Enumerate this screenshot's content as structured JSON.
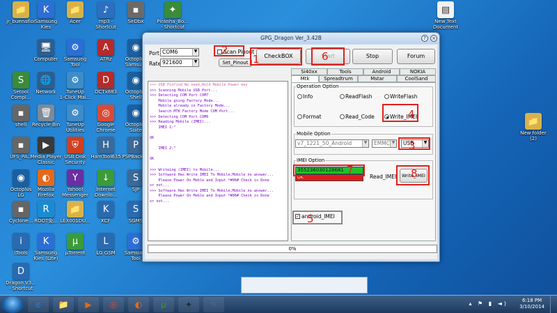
{
  "desktop_icons": [
    {
      "label": "jr_buenaflor",
      "icon": "user-folder-icon",
      "color": "#d7b24a",
      "glyph": "📁"
    },
    {
      "label": "Samsung\nKies",
      "icon": "kies-icon",
      "color": "#2c6ed5",
      "glyph": "K"
    },
    {
      "label": "Acer",
      "icon": "folder-icon",
      "color": "#d7b24a",
      "glyph": "📁"
    },
    {
      "label": "mp3 -\nShortcut",
      "icon": "mp3-icon",
      "color": "#2d6fbf",
      "glyph": "♪"
    },
    {
      "label": "SeDbx",
      "icon": "folder-icon",
      "color": "#6a6a6a",
      "glyph": "▪"
    },
    {
      "label": "Piranha_Bo...\n- Shortcut",
      "icon": "piranha-icon",
      "color": "#3a8b3a",
      "glyph": "✦"
    },
    {
      "label": "Computer",
      "icon": "computer-icon",
      "color": "#2f5d8c",
      "glyph": "🖥"
    },
    {
      "label": "Samsung\nTool",
      "icon": "samsung-tool-icon",
      "color": "#2c6ed5",
      "glyph": "⚙"
    },
    {
      "label": "ATRz",
      "icon": "atrz-icon",
      "color": "#b52a2a",
      "glyph": "A"
    },
    {
      "label": "Octoplus\nSamsu...",
      "icon": "octoplus-icon",
      "color": "#1b5fa0",
      "glyph": "◉"
    },
    {
      "label": "Setool\nCompl...",
      "icon": "setool-icon",
      "color": "#3a8b3a",
      "glyph": "S"
    },
    {
      "label": "Network",
      "icon": "network-icon",
      "color": "#2f5d8c",
      "glyph": "🌐"
    },
    {
      "label": "TuneUp\n1-Click Mai...",
      "icon": "tuneup-icon",
      "color": "#3e8cc8",
      "glyph": "⚙"
    },
    {
      "label": "DCTx883",
      "icon": "dct-icon",
      "color": "#b52a2a",
      "glyph": "D"
    },
    {
      "label": "Octoplus\nShell",
      "icon": "octoplus-shell-icon",
      "color": "#1b5fa0",
      "glyph": "◉"
    },
    {
      "label": "shell",
      "icon": "shell-icon",
      "color": "#666",
      "glyph": "▪"
    },
    {
      "label": "Recycle Bin",
      "icon": "recycle-bin-icon",
      "color": "#7c8a99",
      "glyph": "🗑"
    },
    {
      "label": "TuneUp\nUtilities",
      "icon": "tuneup-utilities-icon",
      "color": "#3e8cc8",
      "glyph": "⚙"
    },
    {
      "label": "Google\nChrome",
      "icon": "chrome-icon",
      "color": "#d84a38",
      "glyph": "◎"
    },
    {
      "label": "Octoplus\nSuite",
      "icon": "octoplus-suite-icon",
      "color": "#1b5fa0",
      "glyph": "◉"
    },
    {
      "label": "UFS_PA...",
      "icon": "ufs-icon",
      "color": "#666",
      "glyph": "▪"
    },
    {
      "label": "Media Player\nClassic",
      "icon": "media-player-icon",
      "color": "#3a3a3a",
      "glyph": "▶"
    },
    {
      "label": "USB Disk\nSecurity",
      "icon": "usb-security-icon",
      "color": "#d04020",
      "glyph": "⛨"
    },
    {
      "label": "HamTool635",
      "icon": "hamtool-icon",
      "color": "#3a6a9a",
      "glyph": "H"
    },
    {
      "label": "PSPBackt...",
      "icon": "psp-icon",
      "color": "#3a6a9a",
      "glyph": "P"
    },
    {
      "label": "Octoplus\nLG",
      "icon": "octoplus-lg-icon",
      "color": "#1b5fa0",
      "glyph": "◉"
    },
    {
      "label": "Mozilla\nFirefox",
      "icon": "firefox-icon",
      "color": "#e36a1a",
      "glyph": "◐"
    },
    {
      "label": "Yahoo!\nMessenger",
      "icon": "yahoo-icon",
      "color": "#6a2fa0",
      "glyph": "Y"
    },
    {
      "label": "Internet\nDownlo...",
      "icon": "idm-icon",
      "color": "#3a9b3a",
      "glyph": "↓"
    },
    {
      "label": "SJP",
      "icon": "sjp-icon",
      "color": "#3a6a9a",
      "glyph": "S"
    },
    {
      "label": "Cyclone...",
      "icon": "cyclone-icon",
      "color": "#666",
      "glyph": "▪"
    },
    {
      "label": "ROOT免...",
      "icon": "root-icon",
      "color": "#1b8ad0",
      "glyph": "R"
    },
    {
      "label": "LEX001DU...",
      "icon": "folder-icon",
      "color": "#d7b24a",
      "glyph": "📁"
    },
    {
      "label": "KCF",
      "icon": "kcf-icon",
      "color": "#2a6ab0",
      "glyph": "K"
    },
    {
      "label": "SGMS",
      "icon": "sgms-icon",
      "color": "#2a6ab0",
      "glyph": "S"
    },
    {
      "label": "iTools",
      "icon": "itools-icon",
      "color": "#2a6ab0",
      "glyph": "i"
    },
    {
      "label": "Samsung\nKies (Lite)",
      "icon": "kies-lite-icon",
      "color": "#2c6ed5",
      "glyph": "K"
    },
    {
      "label": "µTorrent",
      "icon": "utorrent-icon",
      "color": "#3a9b3a",
      "glyph": "µ"
    },
    {
      "label": "LG GSM",
      "icon": "lg-gsm-icon",
      "color": "#2a6ab0",
      "glyph": "L"
    },
    {
      "label": "Samsung\nTool",
      "icon": "samsung-tool-icon",
      "color": "#2c6ed5",
      "glyph": "⚙"
    },
    {
      "label": "Dragon V3...\n- Shortcut",
      "icon": "dragon-icon",
      "color": "#2a6ab0",
      "glyph": "D"
    }
  ],
  "right_icons": [
    {
      "label": "New Text\nDocument",
      "icon": "text-document-icon",
      "color": "#f2f2f2",
      "glyph": "▤"
    },
    {
      "label": "New folder\n(2)",
      "icon": "folder-icon",
      "color": "#d7b24a",
      "glyph": "📁"
    }
  ],
  "window": {
    "title": "GPG_Dragon  Ver_3.42B",
    "port_label": "Port",
    "port_value": "COM6",
    "rate_label": "Rate",
    "rate_value": "921600",
    "scan_pinout_label": "Scan Pinout",
    "set_pinout_label": "Set_Pinout",
    "checkbox_btn": "CheckBOX",
    "start_btn": "Start",
    "stop_btn": "Stop",
    "forum_btn": "Forum",
    "tabs_row1": [
      "Si40xx",
      "Tools",
      "Android",
      "NOKIA"
    ],
    "tabs_row2": [
      "Mtk",
      "Spreadtrum",
      "Mstar",
      "CoolSand"
    ],
    "operation_option_title": "Operation Option",
    "op_info": "Info",
    "op_readflash": "ReadFlash",
    "op_writeflash": "WriteFlash",
    "op_format": "Format",
    "op_read_code": "Read_Code",
    "op_write_imei": "Write_IMEI",
    "mobile_option_title": "Mobile Option",
    "mobile_model": "v7_1221_50_Android",
    "mobile_chip": "EMMC",
    "mobile_conn": "USB",
    "imei_option_title": "IMEI Option",
    "imei_value": "355236030128681",
    "imei_ok": "OK",
    "read_imei_btn": "Read_IMEI",
    "write_imei_btn": "Write_IMEI",
    "android_imei_label": "android_IMEI",
    "progress_text": "0%"
  },
  "log_lines": [
    ">>> USB Pinfind No need,Hold Mobile Power key",
    ">>> Scanning Mobile USB Port...",
    ">>> Detecting COM Port COM7",
    "    Mobile going Factory Mode...",
    "    Mobile already in Factory Mode...",
    "    Search MTK Factory Mode COM Port...",
    ">>> Detecting COM Port COM6",
    ">>> Reading Mobile (IMEI)...",
    "    IMEI 1:\"",
    "",
    "OK",
    "",
    "    IMEI 2:\"",
    "",
    "OK",
    "",
    ">>> Writeing (IMEI) to Mobile...",
    ">>> Software Has Write IMEI To Mobile;Mobile no answer...",
    "    Please Power On Moble and Input *#06# Check is Done",
    "or not...",
    ">>> Software Has Write IMEI To Mobile;Mobile no answer...",
    "    Please Power On Moble and Input *#06# Check is Done",
    "or not..."
  ],
  "annotations": {
    "n1": "1",
    "n2": "2",
    "n3": "3",
    "n4": "4",
    "n5": "5",
    "n6": "6",
    "n7": "7",
    "n8": "8"
  },
  "taskbar": {
    "time": "6:18 PM",
    "date": "3/10/2014",
    "apps": [
      {
        "icon": "ie-icon",
        "glyph": "e",
        "color": "#2b7ad6"
      },
      {
        "icon": "explorer-icon",
        "glyph": "📁",
        "color": "#d7b24a"
      },
      {
        "icon": "media-player-icon",
        "glyph": "▶",
        "color": "#e06a1a"
      },
      {
        "icon": "chrome-icon",
        "glyph": "◎",
        "color": "#d84a38"
      },
      {
        "icon": "firefox-icon",
        "glyph": "◐",
        "color": "#e36a1a"
      },
      {
        "icon": "utorrent-icon",
        "glyph": "µ",
        "color": "#3a9b3a"
      },
      {
        "icon": "dragon-icon",
        "glyph": "✦",
        "color": "#1a2a40"
      },
      {
        "icon": "paint-icon",
        "glyph": "✎",
        "color": "#3a6aa0"
      }
    ]
  }
}
